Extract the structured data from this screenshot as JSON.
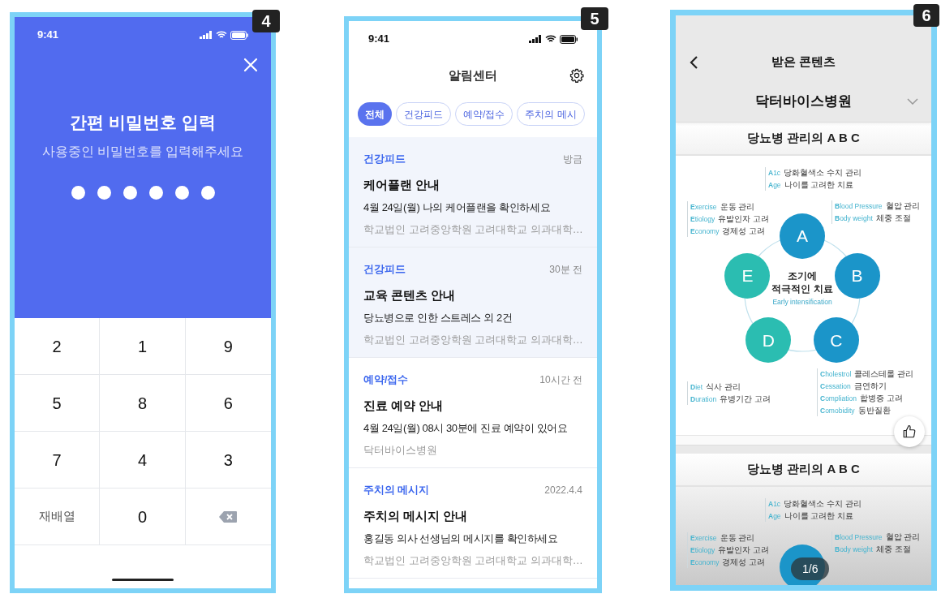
{
  "passcode_screen": {
    "badge": "4",
    "status_time": "9:41",
    "title": "간편 비밀번호 입력",
    "subtitle": "사용중인 비밀번호를 입력해주세요",
    "pin_dots": [
      {
        "filled": true
      },
      {
        "filled": true
      },
      {
        "filled": true
      },
      {
        "filled": true
      },
      {
        "filled": true
      },
      {
        "filled": true
      }
    ],
    "keys": [
      {
        "kind": "digit",
        "label": "2"
      },
      {
        "kind": "digit",
        "label": "1"
      },
      {
        "kind": "digit",
        "label": "9"
      },
      {
        "kind": "digit",
        "label": "5"
      },
      {
        "kind": "digit",
        "label": "8"
      },
      {
        "kind": "digit",
        "label": "6"
      },
      {
        "kind": "digit",
        "label": "7"
      },
      {
        "kind": "digit",
        "label": "4"
      },
      {
        "kind": "digit",
        "label": "3"
      },
      {
        "kind": "text",
        "label": "재배열"
      },
      {
        "kind": "digit",
        "label": "0"
      },
      {
        "kind": "backspace"
      }
    ]
  },
  "notification_screen": {
    "badge": "5",
    "status_time": "9:41",
    "title": "알림센터",
    "tabs": [
      {
        "label": "전체",
        "selected": true
      },
      {
        "label": "건강피드",
        "selected": false
      },
      {
        "label": "예약/접수",
        "selected": false
      },
      {
        "label": "주치의 메시",
        "selected": false
      }
    ],
    "items": [
      {
        "category": "건강피드",
        "time": "방금",
        "title": "케어플랜 안내",
        "body": "4월 24일(월) 나의 케어플랜을 확인하세요",
        "source": "학교법인 고려중앙학원 고려대학교 의과대학…",
        "unread": true
      },
      {
        "category": "건강피드",
        "time": "30분 전",
        "title": "교육 콘텐츠 안내",
        "body": "당뇨병으로 인한 스트레스 외 2건",
        "source": "학교법인 고려중앙학원 고려대학교 의과대학…",
        "unread": true
      },
      {
        "category": "예약/접수",
        "time": "10시간 전",
        "title": "진료 예약 안내",
        "body": "4월 24일(월) 08시 30분에 진료 예약이 있어요",
        "source": "닥터바이스병원",
        "unread": false
      },
      {
        "category": "주치의 메시지",
        "time": "2022.4.4",
        "title": "주치의 메시지 안내",
        "body": "홍길동 의사 선생님의 메시지를 확인하세요",
        "source": "학교법인 고려중앙학원 고려대학교 의과대학…",
        "unread": false
      }
    ]
  },
  "content_screen": {
    "badge": "6",
    "title": "받은 콘텐츠",
    "hospital": "닥터바이스병원",
    "page_indicator": "1/6",
    "slides": [
      {
        "title": "당뇨병 관리의 A B C",
        "center": {
          "lines": [
            "조기에",
            "적극적인 치료"
          ],
          "caption": "Early intensification"
        },
        "nodes": [
          {
            "letter": "A",
            "color": "#1b95c9"
          },
          {
            "letter": "B",
            "color": "#1b95c9"
          },
          {
            "letter": "C",
            "color": "#1b95c9"
          },
          {
            "letter": "D",
            "color": "#2bbdb1"
          },
          {
            "letter": "E",
            "color": "#2bbdb1"
          }
        ],
        "label_groups": [
          {
            "rows": [
              {
                "term": "**A**1c",
                "meaning": "당화혈색소 수치 관리"
              },
              {
                "term": "**A**ge",
                "meaning": "나이를 고려한 치료"
              }
            ]
          },
          {
            "rows": [
              {
                "term": "**E**xercise",
                "meaning": "운동 관리"
              },
              {
                "term": "**E**tiology",
                "meaning": "유발인자 고려"
              },
              {
                "term": "**E**conomy",
                "meaning": "경제성 고려"
              }
            ]
          },
          {
            "rows": [
              {
                "term": "**B**lood Pressure",
                "meaning": "혈압 관리"
              },
              {
                "term": "**B**ody weight",
                "meaning": "체중 조절"
              }
            ]
          },
          {
            "rows": [
              {
                "term": "**D**iet",
                "meaning": "식사 관리"
              },
              {
                "term": "**D**uration",
                "meaning": "유병기간 고려"
              }
            ]
          },
          {
            "rows": [
              {
                "term": "**C**holestrol",
                "meaning": "콜레스테롤 관리"
              },
              {
                "term": "**C**essation",
                "meaning": "금연하기"
              },
              {
                "term": "**C**ompliation",
                "meaning": "합병증 고려"
              },
              {
                "term": "**C**omobidity",
                "meaning": "동반질환"
              }
            ]
          }
        ]
      },
      {
        "title": "당뇨병 관리의 A B C",
        "nodes": [
          {
            "color": "#1b95c9"
          }
        ],
        "label_groups": [
          {
            "rows": [
              {
                "term": "**A**1c",
                "meaning": "당화혈색소 수치 관리"
              },
              {
                "term": "**A**ge",
                "meaning": "나이를 고려한 치료"
              }
            ]
          },
          {
            "rows": [
              {
                "term": "**E**xercise",
                "meaning": "운동 관리"
              },
              {
                "term": "**E**tiology",
                "meaning": "유발인자 고려"
              },
              {
                "term": "**E**conomy",
                "meaning": "경제성 고려"
              }
            ]
          },
          {
            "rows": [
              {
                "term": "**B**lood Pressure",
                "meaning": "혈압 관리"
              },
              {
                "term": "**B**ody weight",
                "meaning": "체중 조절"
              }
            ]
          }
        ]
      }
    ]
  }
}
